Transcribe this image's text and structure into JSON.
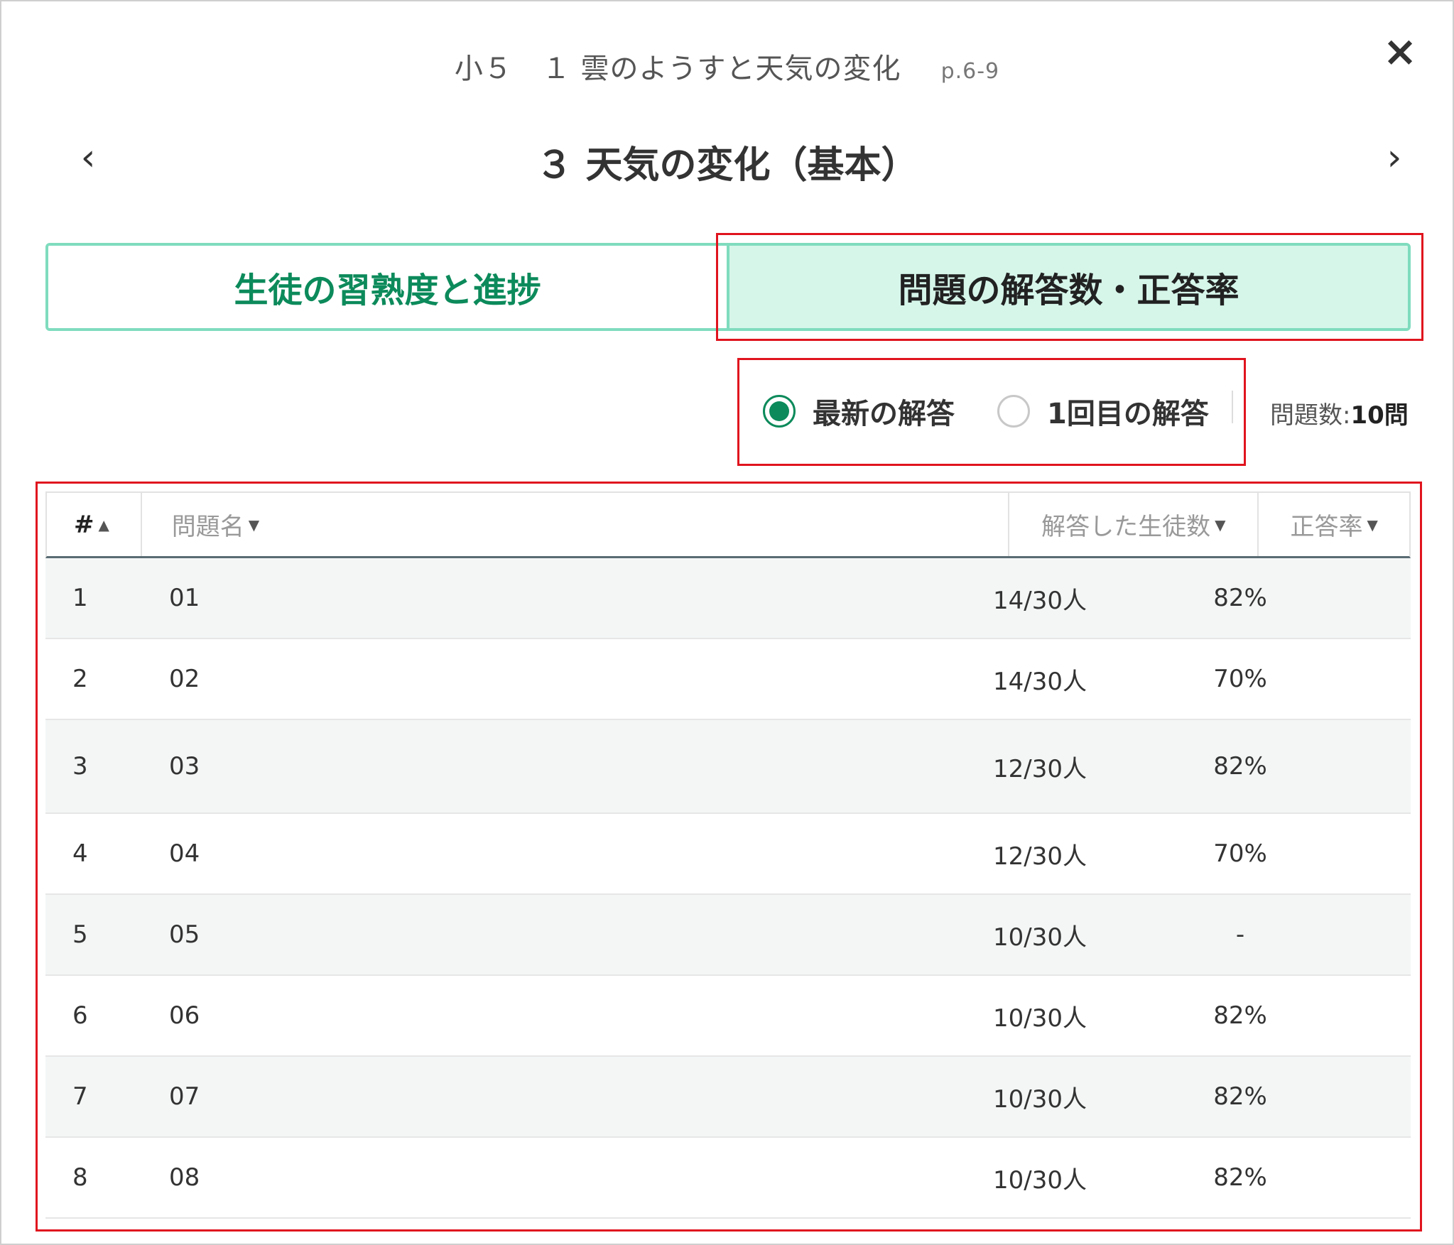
{
  "header": {
    "breadcrumb": "小５　１ 雲のようすと天気の変化",
    "pages": "p.6-9",
    "lesson_title": "３ 天気の変化（基本）",
    "close_label": "×",
    "prev_label": "‹",
    "next_label": "›"
  },
  "tabs": [
    {
      "label": "生徒の習熟度と進捗",
      "active": false
    },
    {
      "label": "問題の解答数・正答率",
      "active": true
    }
  ],
  "filter": {
    "options": [
      {
        "label": "最新の解答",
        "checked": true
      },
      {
        "label": "1回目の解答",
        "checked": false
      }
    ],
    "count_label": "問題数:",
    "count_value": "10問"
  },
  "table": {
    "columns": [
      {
        "label": "#",
        "caret": "▲"
      },
      {
        "label": "問題名",
        "caret": "▼"
      },
      {
        "label": "解答した生徒数",
        "caret": "▼"
      },
      {
        "label": "正答率",
        "caret": "▼"
      }
    ],
    "rows": [
      {
        "idx": "1",
        "name": "01",
        "count": "14/30人",
        "rate": "82%"
      },
      {
        "idx": "2",
        "name": "02",
        "count": "14/30人",
        "rate": "70%"
      },
      {
        "idx": "3",
        "name": "03",
        "count": "12/30人",
        "rate": "82%"
      },
      {
        "idx": "4",
        "name": "04",
        "count": "12/30人",
        "rate": "70%"
      },
      {
        "idx": "5",
        "name": "05",
        "count": "10/30人",
        "rate": "-"
      },
      {
        "idx": "6",
        "name": "06",
        "count": "10/30人",
        "rate": "82%"
      },
      {
        "idx": "7",
        "name": "07",
        "count": "10/30人",
        "rate": "82%"
      },
      {
        "idx": "8",
        "name": "08",
        "count": "10/30人",
        "rate": "82%"
      }
    ]
  },
  "colors": {
    "accent_green": "#0c8a5b",
    "tab_border": "#7fdcbe",
    "tab_active_bg": "#d6f6ea",
    "highlight_red": "#e0141e"
  }
}
